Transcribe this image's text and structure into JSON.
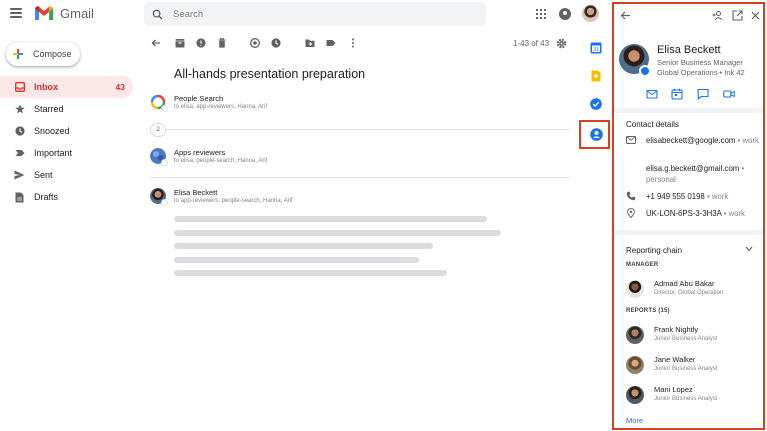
{
  "app": {
    "name": "Gmail"
  },
  "search": {
    "placeholder": "Search"
  },
  "sidebar": {
    "compose_label": "Compose",
    "items": [
      {
        "label": "Inbox",
        "count": "43",
        "icon": "inbox-icon"
      },
      {
        "label": "Starred",
        "icon": "star-icon"
      },
      {
        "label": "Snoozed",
        "icon": "clock-icon"
      },
      {
        "label": "Important",
        "icon": "important-icon"
      },
      {
        "label": "Sent",
        "icon": "send-icon"
      },
      {
        "label": "Drafts",
        "icon": "draft-icon"
      }
    ]
  },
  "toolbar": {
    "icons": [
      "back-icon",
      "archive-icon",
      "report-spam-icon",
      "delete-icon",
      "mark-unread-icon",
      "snooze-icon",
      "move-to-icon",
      "label-icon",
      "more-vert-icon"
    ],
    "pager": "1-43 of 43",
    "settings_icon": "gear-icon"
  },
  "thread": {
    "subject": "All-hands presentation preparation",
    "collapsed_count": "2",
    "messages": [
      {
        "sender": "People Search",
        "to": "to elisa, app-reviewers, Hanna, Arif"
      },
      {
        "sender": "Apps reviewers",
        "to": "to elisa, people-search, Hanna, Arif"
      },
      {
        "sender": "Elisa Beckett",
        "to": "to app-reviewers, people-search, Hanna, Arif"
      }
    ]
  },
  "rail": {
    "apps": [
      "calendar-icon",
      "keep-icon",
      "tasks-icon",
      "contacts-icon"
    ],
    "active": "contacts-icon"
  },
  "contact": {
    "name": "Elisa Beckett",
    "title": "Senior Business Manager",
    "org": "Global Operations • Ink 42",
    "actions": [
      "email-icon",
      "calendar-icon",
      "chat-icon",
      "video-call-icon"
    ],
    "details_title": "Contact details",
    "email_work": "elisabeckett@google.com",
    "email_work_type": "• work",
    "email_personal": "elisa.g.beckett@gmail.com",
    "email_personal_type": "• personal",
    "phone": "+1 949 555 0198",
    "phone_type": "• work",
    "location": "UK-LON-6PS-3-3H3A",
    "location_type": "• work"
  },
  "reporting": {
    "title": "Reporting chain",
    "manager_label": "MANAGER",
    "manager": {
      "name": "Admad Abu Bakar",
      "role": "Director, Global Operation"
    },
    "reports_label": "REPORTS (15)",
    "reports": [
      {
        "name": "Frank Nightly",
        "role": "Junior Business Analyst"
      },
      {
        "name": "Jane Walker",
        "role": "Junior Business Analyst"
      },
      {
        "name": "Mani Lopez",
        "role": "Junior Business Analyst"
      }
    ],
    "more_label": "More"
  },
  "colors": {
    "accent": "#d93025",
    "highlight_border": "#d9401f",
    "inbox_bg": "#fce8e6",
    "link": "#1a73e8"
  }
}
